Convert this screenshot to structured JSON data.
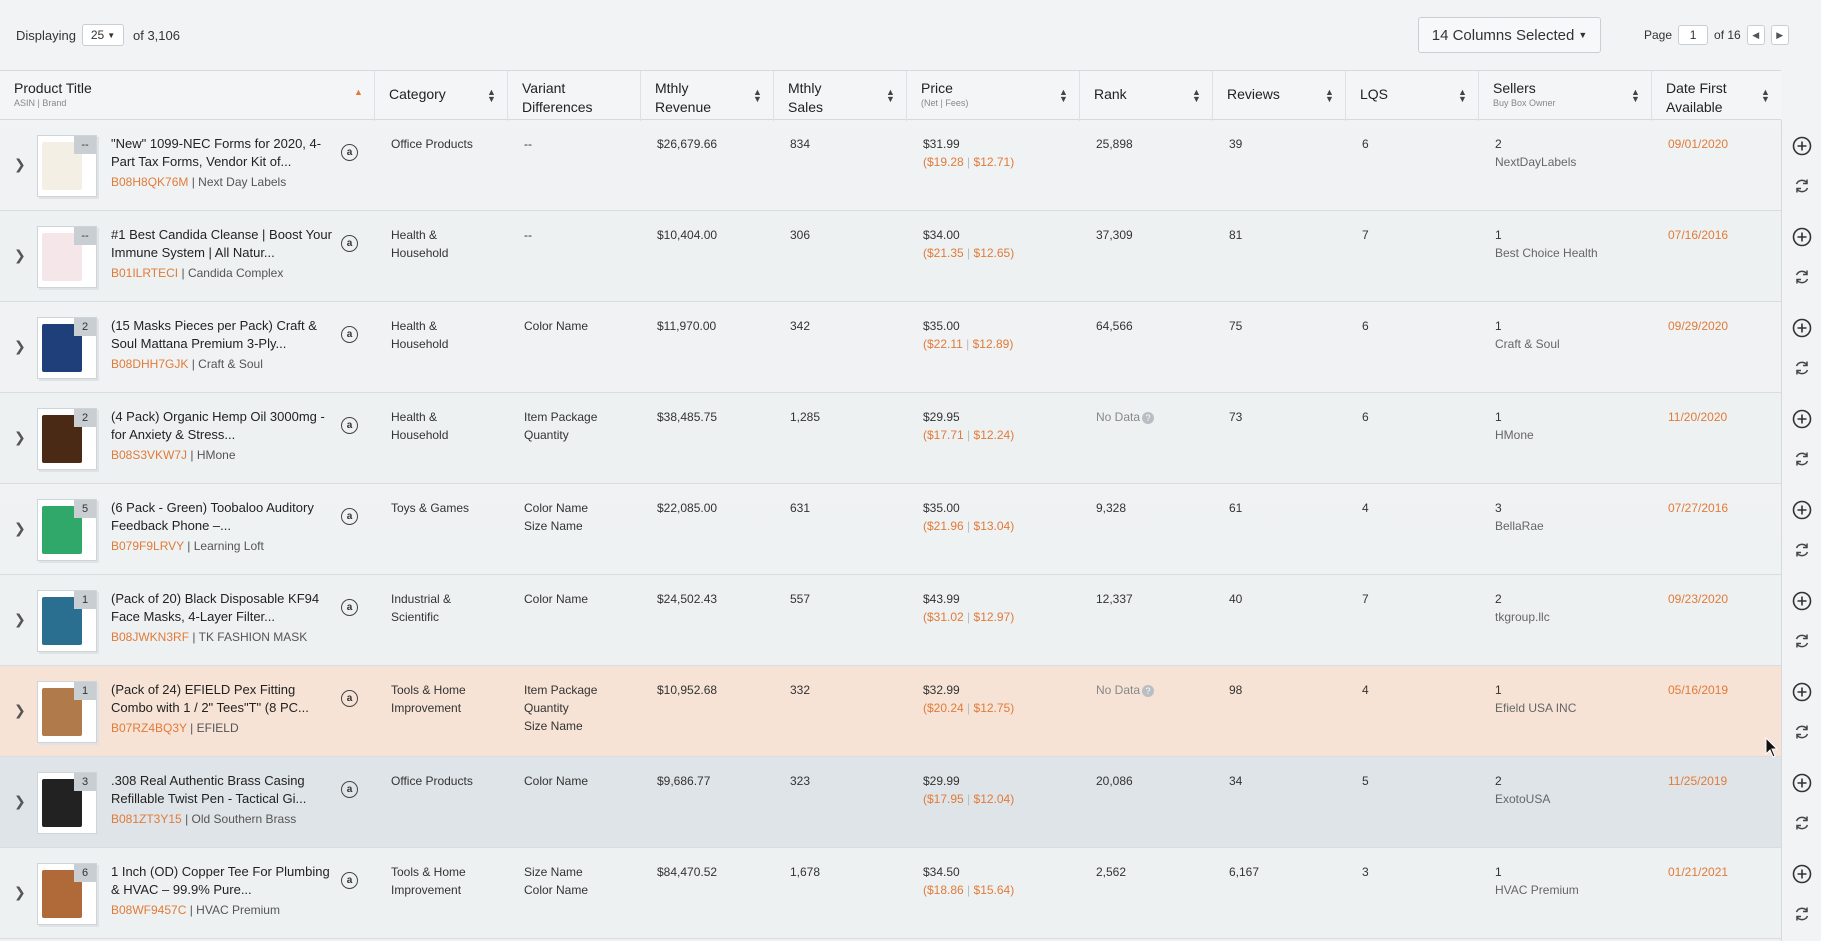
{
  "toolbar": {
    "displaying_label": "Displaying",
    "per_page": "25",
    "of_total": "of 3,106",
    "columns_selected": "14 Columns Selected",
    "page_label": "Page",
    "page_current": "1",
    "page_of": "of 16"
  },
  "columns": {
    "product_title": "Product Title",
    "product_title_sub": "ASIN | Brand",
    "category": "Category",
    "variant_1": "Variant",
    "variant_2": "Differences",
    "revenue_1": "Mthly",
    "revenue_2": "Revenue",
    "sales_1": "Mthly",
    "sales_2": "Sales",
    "price": "Price",
    "price_sub": "(Net | Fees)",
    "rank": "Rank",
    "reviews": "Reviews",
    "lqs": "LQS",
    "sellers": "Sellers",
    "sellers_sub": "Buy Box Owner",
    "date_1": "Date First",
    "date_2": "Available"
  },
  "rows": [
    {
      "badge": "--",
      "title": "\"New\" 1099-NEC Forms for 2020, 4-Part Tax Forms, Vendor Kit of...",
      "asin": "B08H8QK76M",
      "brand": "| Next Day Labels",
      "cat1": "Office Products",
      "cat2": "",
      "var1": "--",
      "var2": "",
      "var3": "",
      "revenue": "$26,679.66",
      "sales": "834",
      "price": "$31.99",
      "net": "($19.28",
      "fees": "$12.71)",
      "rank": "25,898",
      "reviews": "39",
      "lqs": "6",
      "sellers": "2",
      "owner": "NextDayLabels",
      "date": "09/01/2020"
    },
    {
      "badge": "--",
      "title": "#1 Best Candida Cleanse | Boost Your Immune System | All Natur...",
      "asin": "B01ILRTECI",
      "brand": "| Candida Complex",
      "cat1": "Health &",
      "cat2": "Household",
      "var1": "--",
      "var2": "",
      "var3": "",
      "revenue": "$10,404.00",
      "sales": "306",
      "price": "$34.00",
      "net": "($21.35",
      "fees": "$12.65)",
      "rank": "37,309",
      "reviews": "81",
      "lqs": "7",
      "sellers": "1",
      "owner": "Best Choice Health",
      "date": "07/16/2016"
    },
    {
      "badge": "2",
      "title": "(15 Masks Pieces per Pack) Craft & Soul Mattana Premium 3-Ply...",
      "asin": "B08DHH7GJK",
      "brand": "| Craft & Soul",
      "cat1": "Health &",
      "cat2": "Household",
      "var1": "Color Name",
      "var2": "",
      "var3": "",
      "revenue": "$11,970.00",
      "sales": "342",
      "price": "$35.00",
      "net": "($22.11",
      "fees": "$12.89)",
      "rank": "64,566",
      "reviews": "75",
      "lqs": "6",
      "sellers": "1",
      "owner": "Craft & Soul",
      "date": "09/29/2020"
    },
    {
      "badge": "2",
      "title": "(4 Pack) Organic Hemp Oil 3000mg - for Anxiety & Stress...",
      "asin": "B08S3VKW7J",
      "brand": "| HMone",
      "cat1": "Health &",
      "cat2": "Household",
      "var1": "Item Package",
      "var2": "Quantity",
      "var3": "",
      "revenue": "$38,485.75",
      "sales": "1,285",
      "price": "$29.95",
      "net": "($17.71",
      "fees": "$12.24)",
      "rank": "No Data",
      "reviews": "73",
      "lqs": "6",
      "sellers": "1",
      "owner": "HMone",
      "date": "11/20/2020"
    },
    {
      "badge": "5",
      "title": "(6 Pack - Green) Toobaloo Auditory Feedback Phone –...",
      "asin": "B079F9LRVY",
      "brand": "| Learning Loft",
      "cat1": "Toys & Games",
      "cat2": "",
      "var1": "Color Name",
      "var2": "Size Name",
      "var3": "",
      "revenue": "$22,085.00",
      "sales": "631",
      "price": "$35.00",
      "net": "($21.96",
      "fees": "$13.04)",
      "rank": "9,328",
      "reviews": "61",
      "lqs": "4",
      "sellers": "3",
      "owner": "BellaRae",
      "date": "07/27/2016"
    },
    {
      "badge": "1",
      "title": "(Pack of 20) Black Disposable KF94 Face Masks, 4-Layer Filter...",
      "asin": "B08JWKN3RF",
      "brand": "| TK FASHION MASK",
      "cat1": "Industrial &",
      "cat2": "Scientific",
      "var1": "Color Name",
      "var2": "",
      "var3": "",
      "revenue": "$24,502.43",
      "sales": "557",
      "price": "$43.99",
      "net": "($31.02",
      "fees": "$12.97)",
      "rank": "12,337",
      "reviews": "40",
      "lqs": "7",
      "sellers": "2",
      "owner": "tkgroup.llc",
      "date": "09/23/2020"
    },
    {
      "badge": "1",
      "title": "(Pack of 24) EFIELD Pex Fitting Combo with 1 / 2\" Tees\"T\" (8 PC...",
      "asin": "B07RZ4BQ3Y",
      "brand": "| EFIELD",
      "cat1": "Tools & Home",
      "cat2": "Improvement",
      "var1": "Item Package",
      "var2": "Quantity",
      "var3": "Size Name",
      "revenue": "$10,952.68",
      "sales": "332",
      "price": "$32.99",
      "net": "($20.24",
      "fees": "$12.75)",
      "rank": "No Data",
      "reviews": "98",
      "lqs": "4",
      "sellers": "1",
      "owner": "Efield USA INC",
      "date": "05/16/2019"
    },
    {
      "badge": "3",
      "title": ".308 Real Authentic Brass Casing Refillable Twist Pen - Tactical Gi...",
      "asin": "B081ZT3Y15",
      "brand": "| Old Southern Brass",
      "cat1": "Office Products",
      "cat2": "",
      "var1": "Color Name",
      "var2": "",
      "var3": "",
      "revenue": "$9,686.77",
      "sales": "323",
      "price": "$29.99",
      "net": "($17.95",
      "fees": "$12.04)",
      "rank": "20,086",
      "reviews": "34",
      "lqs": "5",
      "sellers": "2",
      "owner": "ExotoUSA",
      "date": "11/25/2019"
    },
    {
      "badge": "6",
      "title": "1 Inch (OD) Copper Tee For Plumbing & HVAC – 99.9% Pure...",
      "asin": "B08WF9457C",
      "brand": "| HVAC Premium",
      "cat1": "Tools & Home",
      "cat2": "Improvement",
      "var1": "Size Name",
      "var2": "Color Name",
      "var3": "",
      "revenue": "$84,470.52",
      "sales": "1,678",
      "price": "$34.50",
      "net": "($18.86",
      "fees": "$15.64)",
      "rank": "2,562",
      "reviews": "6,167",
      "lqs": "3",
      "sellers": "1",
      "owner": "HVAC Premium",
      "date": "01/21/2021"
    }
  ],
  "colors": {
    "accent": "#e07b39",
    "highlight_row": "#f6e3d6",
    "hover_row": "#dfe4e8"
  }
}
